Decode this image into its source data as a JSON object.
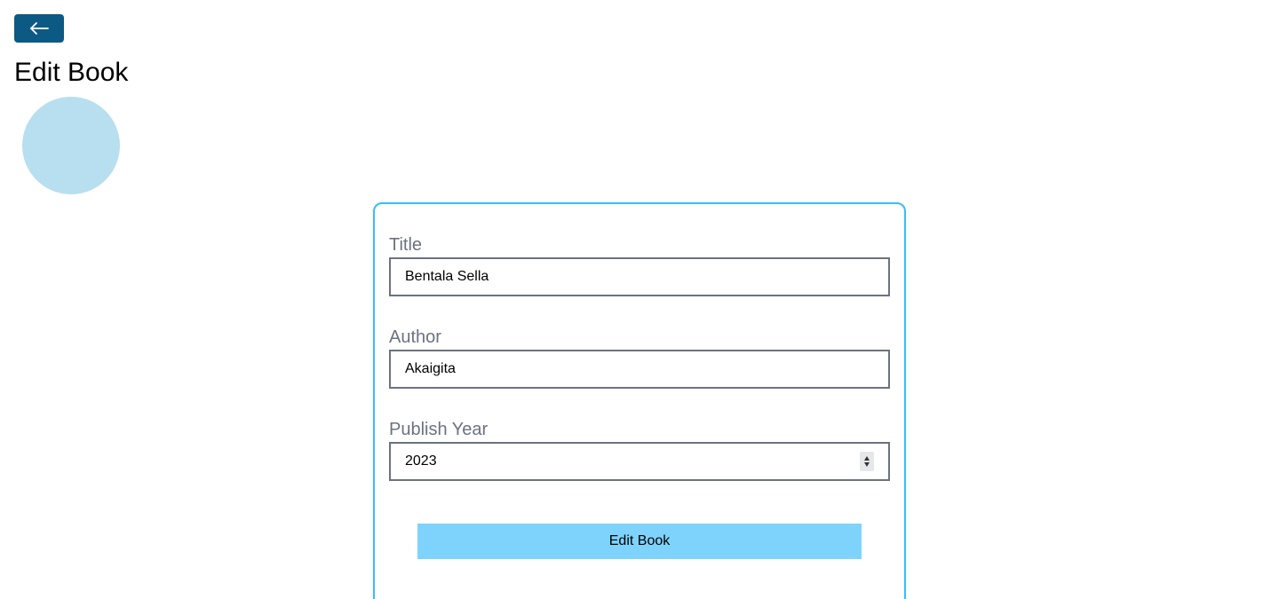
{
  "header": {
    "back_icon": "arrow-left-icon",
    "title": "Edit Book"
  },
  "colors": {
    "back_button": "#0c5a84",
    "spinner": "#b8dff0",
    "card_border": "#38bdf8",
    "submit_button": "#7dd3fc",
    "label": "#6b7280"
  },
  "form": {
    "fields": [
      {
        "label": "Title",
        "value": "Bentala Sella",
        "type": "text"
      },
      {
        "label": "Author",
        "value": "Akaigita",
        "type": "text"
      },
      {
        "label": "Publish Year",
        "value": "2023",
        "type": "number"
      }
    ],
    "submit_label": "Edit Book"
  }
}
